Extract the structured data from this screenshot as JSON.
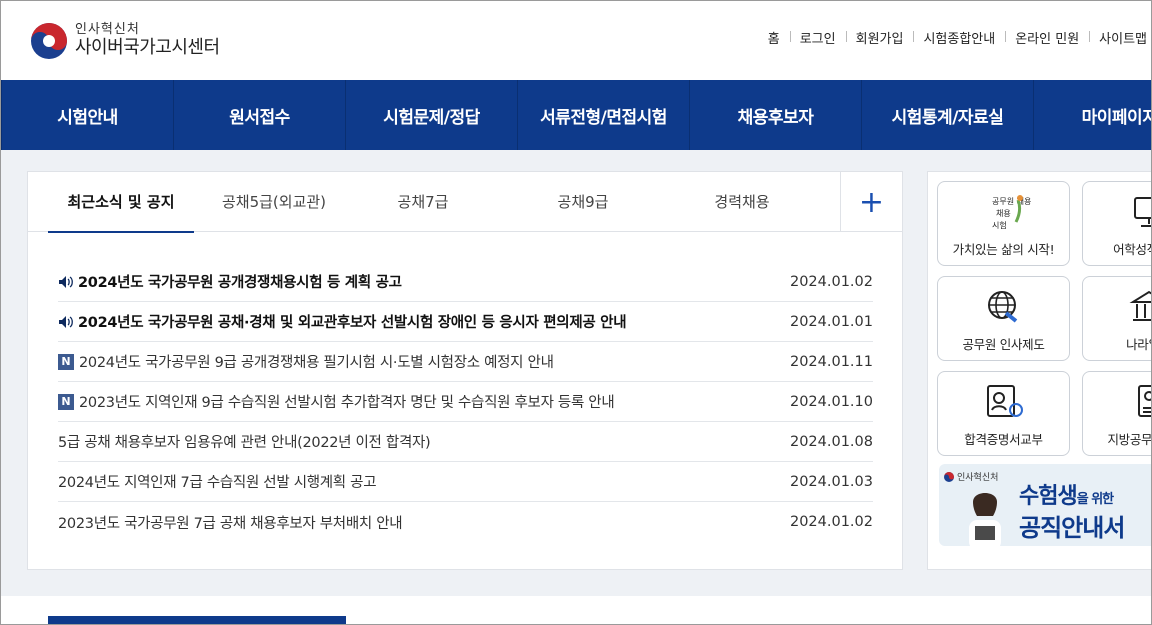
{
  "header": {
    "logo_sub": "인사혁신처",
    "logo_main": "사이버국가고시센터",
    "util_links": [
      "홈",
      "로그인",
      "회원가입",
      "시험종합안내",
      "온라인 민원",
      "사이트맵"
    ]
  },
  "gnb": [
    "시험안내",
    "원서접수",
    "시험문제/정답",
    "서류전형/면접시험",
    "채용후보자",
    "시험통계/자료실",
    "마이페이지"
  ],
  "notice": {
    "tabs": [
      "최근소식 및 공지",
      "공채5급(외교관)",
      "공채7급",
      "공채9급",
      "경력채용"
    ],
    "more": "+",
    "items": [
      {
        "title": "2024년도 국가공무원 공개경쟁채용시험 등 계획 공고",
        "date": "2024.01.02",
        "type": "speaker"
      },
      {
        "title": "2024년도 국가공무원 공채·경채 및 외교관후보자 선발시험 장애인 등 응시자 편의제공 안내",
        "date": "2024.01.01",
        "type": "speaker"
      },
      {
        "title": "2024년도 국가공무원 9급 공개경쟁채용 필기시험 시·도별 시험장소 예정지 안내",
        "date": "2024.01.11",
        "type": "new"
      },
      {
        "title": "2023년도 지역인재 9급 수습직원 선발시험 추가합격자 명단 및 수습직원 후보자 등록 안내",
        "date": "2024.01.10",
        "type": "new"
      },
      {
        "title": "5급 공채 채용후보자 임용유예 관련 안내(2022년 이전 합격자)",
        "date": "2024.01.08",
        "type": "plain"
      },
      {
        "title": "2024년도 지역인재 7급 수습직원 선발 시행계획 공고",
        "date": "2024.01.03",
        "type": "plain"
      },
      {
        "title": "2023년도 국가공무원 7급 공채 채용후보자 부처배치 안내",
        "date": "2024.01.02",
        "type": "plain"
      }
    ],
    "new_badge": "N"
  },
  "quick": [
    {
      "label": "가치있는 삶의 시작!",
      "icon": "value-life-icon",
      "icon_text": "공무원 채용 시험"
    },
    {
      "label": "어학성적 조회",
      "icon": "monitor-icon"
    },
    {
      "label": "공무원 인사제도",
      "icon": "globe-icon"
    },
    {
      "label": "나라일터",
      "icon": "building-icon"
    },
    {
      "label": "합격증명서교부",
      "icon": "certificate-icon"
    },
    {
      "label": "지방공무원 채용",
      "icon": "document-person-icon"
    }
  ],
  "banner": {
    "logo": "인사혁신처",
    "line1_a": "수험생",
    "line1_b": "을 위한",
    "line2": "공직안내서"
  },
  "colors": {
    "primary": "#0e3a8b",
    "accent": "#1a4fb0",
    "badge": "#3c5a90"
  }
}
